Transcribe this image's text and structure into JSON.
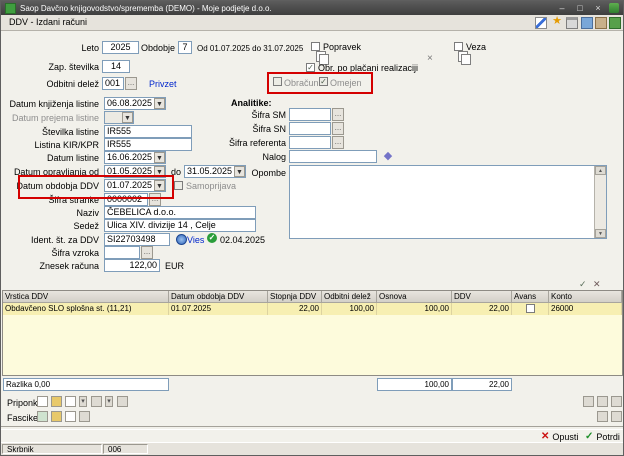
{
  "titlebar": {
    "title": "Saop Davčno knjigovodstvo/sprememba (DEMO) - Moje podjetje d.o.o.",
    "minimize": "–",
    "maximize": "□",
    "close": "×"
  },
  "toolbar": {
    "form_title": "DDV - Izdani računi"
  },
  "top": {
    "leto_label": "Leto",
    "leto": "2025",
    "obdobje_label": "Obdobje",
    "obdobje": "7",
    "obdobje_range": "Od 01.07.2025 do 31.07.2025",
    "popravek_label": "Popravek",
    "veza_label": "Veza",
    "zap_label": "Zap. številka",
    "zap": "14",
    "obr_placani_label": "Obr. po plačani realizaciji",
    "odbitni_label": "Odbitni delež",
    "odbitni": "001",
    "privzet_label": "Privzet",
    "obracun_label": "Obračun",
    "omejen_label": "Omejen"
  },
  "left": {
    "datum_knjizenja_label": "Datum knjiženja listine",
    "datum_knjizenja": "06.08.2025",
    "datum_prejema_label": "Datum prejema listine",
    "datum_prejema": "",
    "stevilka_listine_label": "Številka listine",
    "stevilka_listine": "IR555",
    "listina_kir_label": "Listina KIR/KPR",
    "listina_kir": "IR555",
    "datum_listine_label": "Datum listine",
    "datum_listine": "16.06.2025",
    "datum_opravljanja_label": "Datum opravljanja od",
    "datum_od": "01.05.2025",
    "do_label": "do",
    "datum_do": "31.05.2025",
    "datum_obdobja_label": "Datum obdobja DDV",
    "datum_obdobja": "01.07.2025",
    "samoprijava_label": "Samoprijava",
    "sifra_stranke_label": "Šifra stranke",
    "sifra_stranke": "0000002",
    "naziv_label": "Naziv",
    "naziv": "ČEBELICA d.o.o.",
    "sedez_label": "Sedež",
    "sedez": "Ulica XIV. divizije 14 , Celje",
    "ident_label": "Ident. št. za DDV",
    "ident": "SI22703498",
    "vies_label": "Vies",
    "vies_datum": "02.04.2025",
    "sifra_vzroka_label": "Šifra vzroka",
    "sifra_vzroka": "",
    "znesek_label": "Znesek računa",
    "znesek": "122,00",
    "valuta": "EUR"
  },
  "analitike": {
    "title": "Analitike:",
    "sifra_sm_label": "Šifra SM",
    "sifra_sm": "",
    "sifra_sn_label": "Šifra SN",
    "sifra_sn": "",
    "sifra_referenta_label": "Šifra referenta",
    "sifra_referenta": "",
    "nalog_label": "Nalog",
    "nalog": "",
    "opombe_label": "Opombe",
    "opombe": ""
  },
  "checks": {
    "popravek": "",
    "veza": "",
    "obr_placani": "✓",
    "obracun": "",
    "omejen": "✓",
    "samoprijava": "",
    "avans": ""
  },
  "grid": {
    "columns": [
      "Vrstica DDV",
      "Datum obdobja DDV",
      "Stopnja DDV",
      "Odbitni delež",
      "Osnova",
      "DDV",
      "Avans",
      "Konto"
    ],
    "row": [
      "Obdavčeno SLO splošna st. (11,21)",
      "01.07.2025",
      "22,00",
      "100,00",
      "100,00",
      "22,00",
      "",
      "26000"
    ],
    "razlika": "Razlika 0,00",
    "sum_osnova": "100,00",
    "sum_ddv": "22,00"
  },
  "bottom": {
    "priponke_label": "Priponke",
    "fascikel_label": "Fascikel",
    "opusti": "Opusti",
    "potrdi": "Potrdi",
    "opusti_icon": "✕",
    "potrdi_icon": "✓"
  },
  "statusbar": {
    "user": "Skrbnik",
    "firm": "006"
  },
  "icons": {
    "star": "★",
    "dots": "…",
    "combo_arrow": "▼",
    "dropdown_arrow": "▾",
    "diamond": "◆",
    "check": "✓",
    "cross": "✕",
    "clear": "×",
    "scroll_up": "▲",
    "scroll_down": "▼",
    "vies_check": "✓",
    "grid_post": "✓",
    "grid_cancel": "✕"
  },
  "colors": {
    "annotation_red": "#d40000",
    "link_blue": "#0026cc",
    "valid_green": "#2a9d3a",
    "grid_yellow": "#fdfbdc"
  }
}
